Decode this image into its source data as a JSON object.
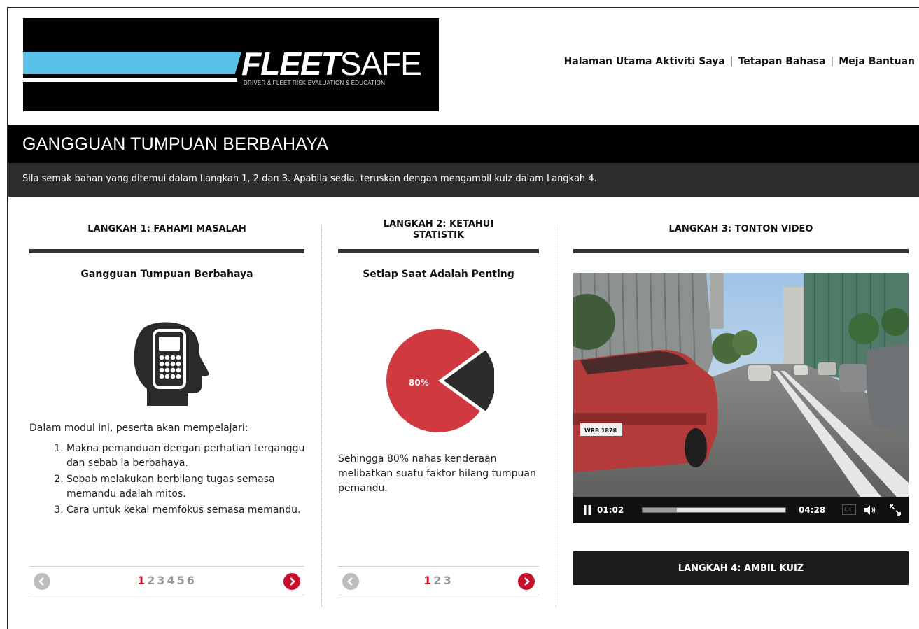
{
  "logo": {
    "brand_bold": "FLEET",
    "brand_light": "SAFE",
    "tagline": "DRIVER & FLEET RISK EVALUATION & EDUCATION"
  },
  "topnav": {
    "home": "Halaman Utama Aktiviti Saya",
    "language": "Tetapan Bahasa",
    "help": "Meja Bantuan",
    "separator": "|"
  },
  "page": {
    "title": "GANGGUAN TUMPUAN BERBAHAYA",
    "instructions": "Sila semak bahan yang ditemui dalam Langkah 1, 2 dan 3. Apabila sedia, teruskan dengan mengambil kuiz dalam Langkah 4."
  },
  "step1": {
    "heading": "LANGKAH 1: FAHAMI MASALAH",
    "item_title": "Gangguan Tumpuan Berbahaya",
    "icon": "head-phone-icon",
    "intro": "Dalam modul ini, peserta akan mempelajari:",
    "list": [
      "Makna pemanduan dengan perhatian terganggu dan sebab ia berbahaya.",
      "Sebab melakukan berbilang tugas semasa memandu adalah mitos.",
      "Cara untuk kekal memfokus semasa memandu."
    ],
    "pages": [
      "1",
      "2",
      "3",
      "4",
      "5",
      "6"
    ],
    "active_page": 1
  },
  "step2": {
    "heading_line1": "LANGKAH 2: KETAHUI",
    "heading_line2": "STATISTIK",
    "item_title": "Setiap Saat Adalah Penting",
    "pie_label": "80%",
    "pie_value": 80,
    "pie_color_main": "#d0393f",
    "pie_color_rest": "#2b2b2b",
    "desc": "Sehingga 80% nahas kenderaan melibatkan suatu faktor hilang tumpuan pemandu.",
    "pages": [
      "1",
      "2",
      "3"
    ],
    "active_page": 1
  },
  "step3": {
    "heading": "LANGKAH 3: TONTON VIDEO",
    "current_time": "01:02",
    "duration": "04:28",
    "cc_label": "CC",
    "progress": 0.24,
    "plate": "WRB 1878"
  },
  "step4": {
    "heading": "LANGKAH 4: AMBIL KUIZ"
  },
  "colors": {
    "accent_red": "#c8102e",
    "logo_blue": "#5bc0e8",
    "dark_band": "#000000",
    "sub_band": "#2d2d2d"
  }
}
